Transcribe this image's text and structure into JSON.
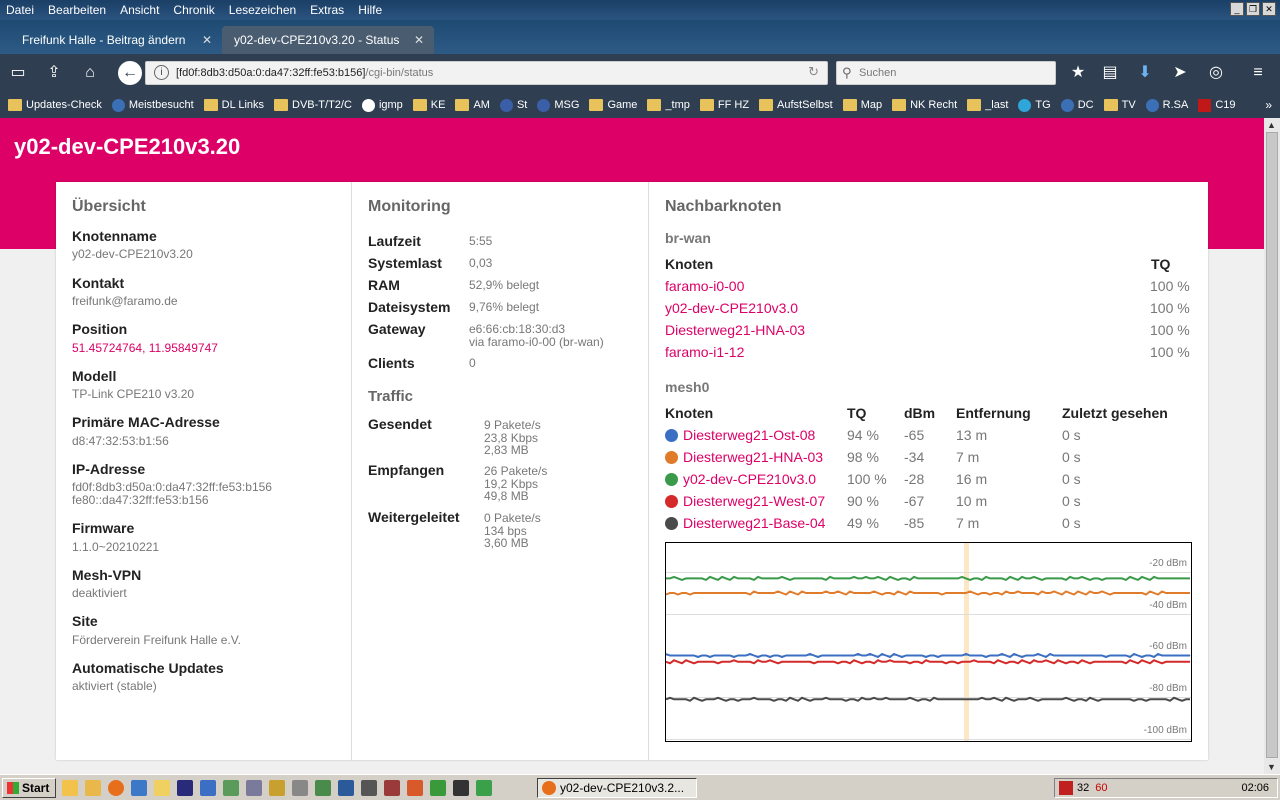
{
  "menu": [
    "Datei",
    "Bearbeiten",
    "Ansicht",
    "Chronik",
    "Lesezeichen",
    "Extras",
    "Hilfe"
  ],
  "tabs": [
    {
      "title": "Freifunk Halle - Beitrag ändern"
    },
    {
      "title": "y02-dev-CPE210v3.20 - Status"
    }
  ],
  "nav": {
    "url_host": "[fd0f:8db3:d50a:0:da47:32ff:fe53:b156]",
    "url_path": "/cgi-bin/status",
    "search_placeholder": "Suchen"
  },
  "bookmarks": [
    "Updates-Check",
    "Meistbesucht",
    "DL Links",
    "DVB-T/T2/C",
    "igmp",
    "KE",
    "AM",
    "St",
    "MSG",
    "Game",
    "_tmp",
    "FF HZ",
    "AufstSelbst",
    "Map",
    "NK Recht",
    "_last",
    "TG",
    "DC",
    "TV",
    "R.SA",
    "C19"
  ],
  "page": {
    "hostname": "y02-dev-CPE210v3.20",
    "overview": {
      "title": "Übersicht",
      "items": [
        {
          "label": "Knotenname",
          "value": "y02-dev-CPE210v3.20"
        },
        {
          "label": "Kontakt",
          "value": "freifunk@faramo.de"
        },
        {
          "label": "Position",
          "value": "51.45724764, 11.95849747"
        },
        {
          "label": "Modell",
          "value": "TP-Link CPE210 v3.20"
        },
        {
          "label": "Primäre MAC-Adresse",
          "value": "d8:47:32:53:b1:56"
        },
        {
          "label": "IP-Adresse",
          "value": "fd0f:8db3:d50a:0:da47:32ff:fe53:b156",
          "value2": "fe80::da47:32ff:fe53:b156"
        },
        {
          "label": "Firmware",
          "value": "1.1.0~20210221"
        },
        {
          "label": "Mesh-VPN",
          "value": "deaktiviert"
        },
        {
          "label": "Site",
          "value": "Förderverein Freifunk Halle e.V."
        },
        {
          "label": "Automatische Updates",
          "value": "aktiviert (stable)"
        }
      ]
    },
    "monitoring": {
      "title": "Monitoring",
      "rows": [
        {
          "label": "Laufzeit",
          "value": "5:55"
        },
        {
          "label": "Systemlast",
          "value": "0,03"
        },
        {
          "label": "RAM",
          "value": "52,9% belegt"
        },
        {
          "label": "Dateisystem",
          "value": "9,76% belegt"
        },
        {
          "label": "Gateway",
          "value": "e6:66:cb:18:30:d3",
          "value2": "via faramo-i0-00 (br-wan)"
        },
        {
          "label": "Clients",
          "value": "0"
        }
      ],
      "traffic_title": "Traffic",
      "traffic": [
        {
          "label": "Gesendet",
          "l1": "9 Pakete/s",
          "l2": "23,8 Kbps",
          "l3": "2,83 MB"
        },
        {
          "label": "Empfangen",
          "l1": "26 Pakete/s",
          "l2": "19,2 Kbps",
          "l3": "49,8 MB"
        },
        {
          "label": "Weitergeleitet",
          "l1": "0 Pakete/s",
          "l2": "134 bps",
          "l3": "3,60 MB"
        }
      ]
    },
    "neighbours": {
      "title": "Nachbarknoten",
      "brwan": {
        "name": "br-wan",
        "headers": [
          "Knoten",
          "TQ"
        ],
        "rows": [
          {
            "node": "faramo-i0-00",
            "tq": "100 %"
          },
          {
            "node": "y02-dev-CPE210v3.0",
            "tq": "100 %"
          },
          {
            "node": "Diesterweg21-HNA-03",
            "tq": "100 %"
          },
          {
            "node": "faramo-i1-12",
            "tq": "100 %"
          }
        ]
      },
      "mesh0": {
        "name": "mesh0",
        "headers": [
          "Knoten",
          "TQ",
          "dBm",
          "Entfernung",
          "Zuletzt gesehen"
        ],
        "rows": [
          {
            "node": "Diesterweg21-Ost-08",
            "tq": "94 %",
            "dbm": "-65",
            "dist": "13 m",
            "seen": "0 s",
            "color": "#3a6fc4"
          },
          {
            "node": "Diesterweg21-HNA-03",
            "tq": "98 %",
            "dbm": "-34",
            "dist": "7 m",
            "seen": "0 s",
            "color": "#e07b2a"
          },
          {
            "node": "y02-dev-CPE210v3.0",
            "tq": "100 %",
            "dbm": "-28",
            "dist": "16 m",
            "seen": "0 s",
            "color": "#3a9a4a"
          },
          {
            "node": "Diesterweg21-West-07",
            "tq": "90 %",
            "dbm": "-67",
            "dist": "10 m",
            "seen": "0 s",
            "color": "#d42a2a"
          },
          {
            "node": "Diesterweg21-Base-04",
            "tq": "49 %",
            "dbm": "-85",
            "dist": "7 m",
            "seen": "0 s",
            "color": "#4a4a4a"
          }
        ]
      },
      "graph": {
        "labels": [
          "-20 dBm",
          "-40 dBm",
          "-60 dBm",
          "-80 dBm",
          "-100 dBm"
        ],
        "ylim": [
          -10,
          -105
        ],
        "series": [
          {
            "dbm": -27,
            "color": "#3a9a4a"
          },
          {
            "dbm": -34,
            "color": "#e07b2a"
          },
          {
            "dbm": -64,
            "color": "#3a6fc4"
          },
          {
            "dbm": -67,
            "color": "#d42a2a"
          },
          {
            "dbm": -85,
            "color": "#4a4a4a"
          }
        ]
      }
    }
  },
  "taskbar": {
    "start": "Start",
    "window": "y02-dev-CPE210v3.2...",
    "tray1": "32",
    "tray2": "60",
    "clock": "02:06"
  }
}
